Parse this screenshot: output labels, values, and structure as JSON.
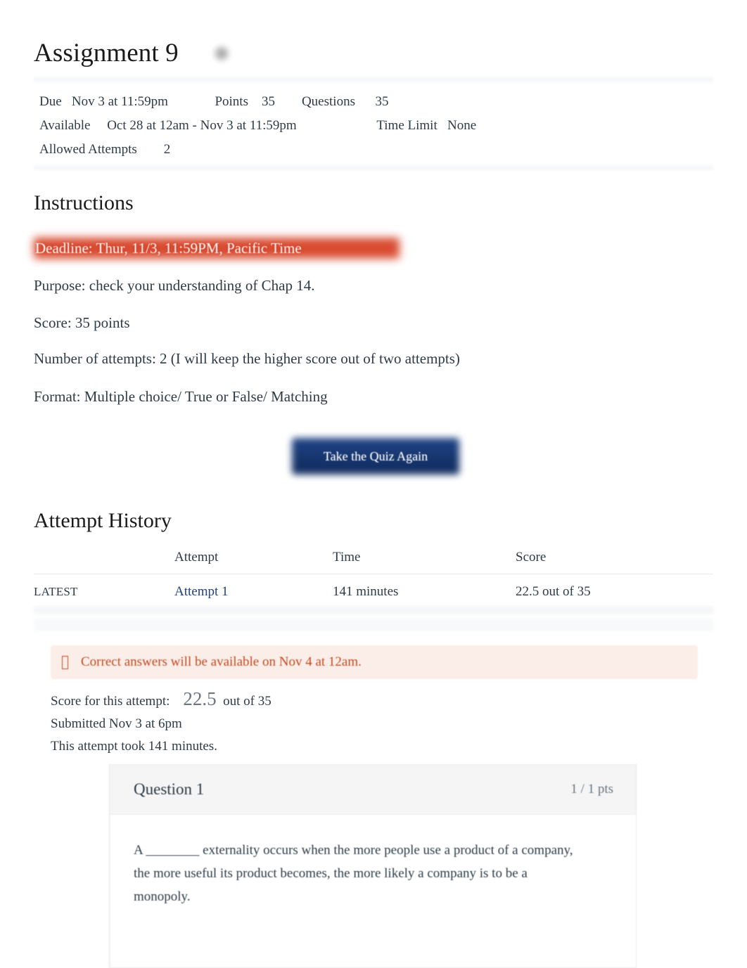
{
  "quiz": {
    "title": "Assignment 9",
    "published_icon": "published-check-icon"
  },
  "details": {
    "due_label": "Due",
    "due_value": "Nov 3 at 11:59pm",
    "points_label": "Points",
    "points_value": "35",
    "questions_label": "Questions",
    "questions_value": "35",
    "available_label": "Available",
    "available_value": "Oct 28 at 12am - Nov 3 at 11:59pm",
    "time_limit_label": "Time Limit",
    "time_limit_value": "None",
    "allowed_attempts_label": "Allowed Attempts",
    "allowed_attempts_value": "2",
    "line1": "Due   Nov 3 at 11:59pm              Points    35        Questions      35",
    "line2": "Available     Oct 28 at 12am - Nov 3 at 11:59pm                        Time Limit   None",
    "line3": "Allowed Attempts        2"
  },
  "instructions": {
    "heading": "Instructions",
    "deadline_banner": "Deadline: Thur, 11/3, 11:59PM, Pacific Time",
    "deadline_highlight_color": "#d64226",
    "paragraphs": [
      "Purpose: check your understanding of Chap 14.",
      "Score: 35 points",
      "Number of attempts: 2 (I will keep the higher score out of two attempts)",
      "Format: Multiple choice/ True or False/ Matching"
    ]
  },
  "actions": {
    "take_quiz_again": "Take the Quiz Again",
    "button_color": "#16356d"
  },
  "attempt_history": {
    "heading": "Attempt History",
    "columns": [
      "",
      "Attempt",
      "Time",
      "Score"
    ],
    "rows": [
      {
        "kept": "LATEST",
        "attempt": "Attempt 1",
        "time": "141 minutes",
        "score": "22.5 out of 35"
      }
    ]
  },
  "notice": {
    "icon": "info-icon",
    "text": "Correct answers will be available on Nov 4 at 12am.",
    "color": "#c4491f"
  },
  "attempt_summary": {
    "score_label": "Score for this attempt:",
    "score_value": "22.5",
    "score_out_of": "out of 35",
    "submitted": "Submitted Nov 3 at 6pm",
    "duration": "This attempt took 141 minutes."
  },
  "questions": [
    {
      "title": "Question 1",
      "points": "1 / 1 pts",
      "text": "A ________ externality occurs when the more people use a product of a company, the more useful its product becomes, the more likely a company is to be a monopoly."
    }
  ]
}
